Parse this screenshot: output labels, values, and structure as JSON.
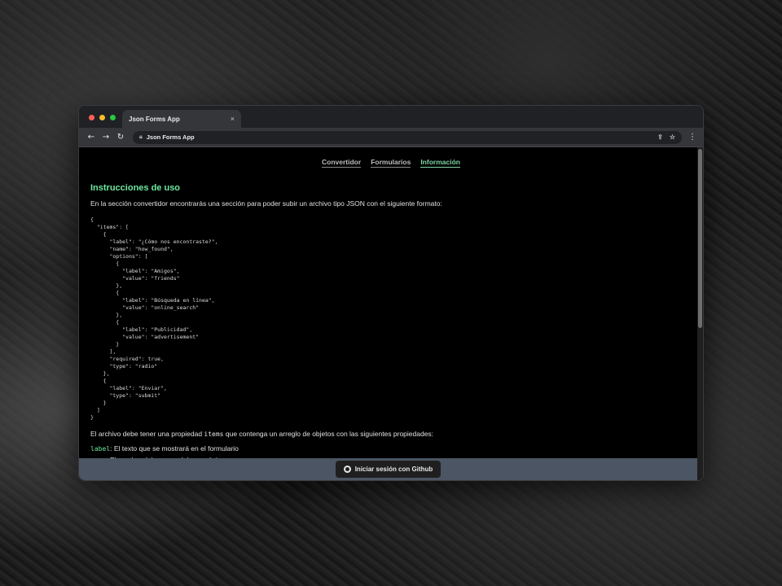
{
  "browser": {
    "tab_title": "Json Forms App",
    "tab_close": "×",
    "address": "Json Forms App",
    "nav_back": "←",
    "nav_forward": "→",
    "nav_reload": "↻",
    "lock_icon": "🔒",
    "share_icon": "⇪",
    "star_icon": "☆",
    "menu_icon": "⋮"
  },
  "nav": {
    "items": [
      {
        "label": "Convertidor"
      },
      {
        "label": "Formularios"
      },
      {
        "label": "Información"
      }
    ],
    "active": "Información"
  },
  "main": {
    "heading": "Instrucciones de uso",
    "intro": "En la sección convertidor encontrarás una sección para poder subir un archivo tipo JSON con el siguiente formato:",
    "code": "{\n  \"items\": [\n    {\n      \"label\": \"¿Cómo nos encontraste?\",\n      \"name\": \"how_found\",\n      \"options\": [\n        {\n          \"label\": \"Amigos\",\n          \"value\": \"friends\"\n        },\n        {\n          \"label\": \"Búsqueda en línea\",\n          \"value\": \"online_search\"\n        },\n        {\n          \"label\": \"Publicidad\",\n          \"value\": \"advertisement\"\n        }\n      ],\n      \"required\": true,\n      \"type\": \"radio\"\n    },\n    {\n      \"label\": \"Enviar\",\n      \"type\": \"submit\"\n    }\n  ]\n}",
    "para2_before": "El archivo debe tener una propiedad ",
    "para2_code": "items",
    "para2_after": " que contenga un arreglo de objetos con las siguientes propiedades:",
    "prop1_key": "label",
    "prop1_text": ": El texto que se mostrará en el formulario",
    "prop2_key": "name",
    "prop2_text": ": El nombre del campo, debe ser único"
  },
  "footer": {
    "button_label": "Iniciar sesión con Github"
  },
  "colors": {
    "accent": "#6ee7a0",
    "footer_bg": "#4b5563"
  }
}
